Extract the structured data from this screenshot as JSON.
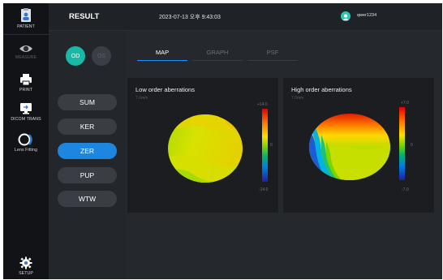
{
  "rail": {
    "patient": "PATIENT",
    "measure": "MEASURE",
    "print": "PRINT",
    "dicom": "DICOM TRANS",
    "lens": "Lens Fitting",
    "setup": "SETUP"
  },
  "topbar": {
    "title": "RESULT",
    "datetime": "2023-07-13 오후 9:43:03",
    "user": "qwer1234"
  },
  "eye": {
    "od": "OD",
    "os": "OS",
    "selected": "OD"
  },
  "modes": {
    "items": [
      "SUM",
      "KER",
      "ZER",
      "PUP",
      "WTW"
    ],
    "active": "ZER"
  },
  "tabs": {
    "items": [
      "MAP",
      "GRAPH",
      "PSF"
    ],
    "active": "MAP"
  },
  "maps": {
    "low": {
      "title": "Low order aberrations",
      "sub": "7.0mm",
      "max": "+14.0",
      "mid": "0",
      "min": "-14.0"
    },
    "high": {
      "title": "High order aberrations",
      "sub": "7.0mm",
      "max": "+7.0",
      "mid": "0",
      "min": "-7.0"
    }
  },
  "colors": {
    "accent_teal": "#18b9a6",
    "accent_blue": "#1d86e1",
    "tab_underline": "#1f90ff"
  }
}
